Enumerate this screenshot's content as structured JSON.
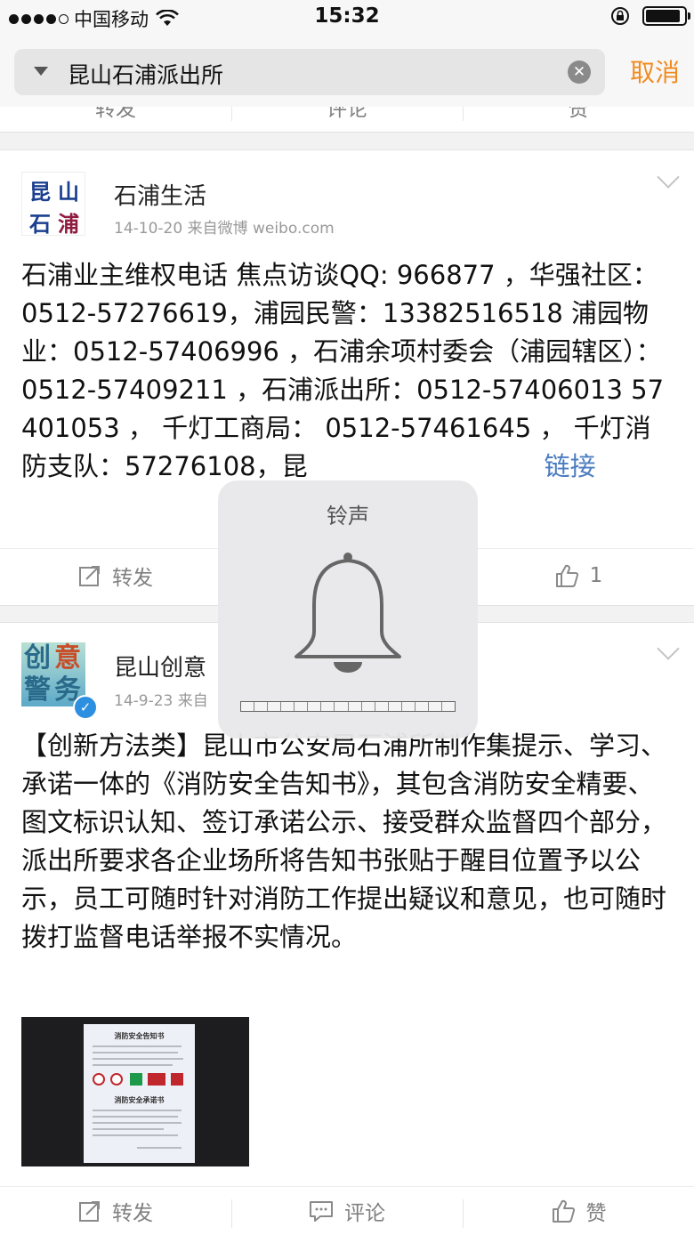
{
  "status_bar": {
    "carrier": "中国移动",
    "time": "15:32",
    "battery_level": 0.9
  },
  "search": {
    "query": "昆山石浦派出所",
    "cancel_label": "取消"
  },
  "posts": [
    {
      "avatar_chars": [
        "昆",
        "山",
        "石",
        "浦"
      ],
      "user_name": "石浦生活",
      "meta": "14-10-20  来自微博 weibo.com",
      "text_visible_left": "石浦业主维权电话 焦点访谈QQ: 966877 ，华强社区： 0512-57276619，浦园民警：13382516518 浦园物业：0512-57406996 ，石浦余项村委会（浦园辖区）： 0512-57409211 ，石浦派出所：0512-57406013 57401053 ， 千灯工商局： 0512-57461645 ， 千灯消防支队：57276108，昆",
      "link_text": "链接",
      "repost_label": "转发",
      "like_count": "1"
    },
    {
      "avatar_chars": [
        "创",
        "意",
        "警",
        "务"
      ],
      "user_name": "昆山创意",
      "meta": "14-9-23  来自",
      "text": "【创新方法类】昆山市公安局石浦所制作集提示、学习、承诺一体的《消防安全告知书》，其包含消防安全精要、图文标识认知、签订承诺公示、接受群众监督四个部分，派出所要求各企业场所将告知书张贴于醒目位置予以公示，员工可随时针对消防工作提出疑议和意见，也可随时拨打监督电话举报不实情况。",
      "photo": {
        "doc_title": "消防安全告知书",
        "doc_subtitle": "消防安全承诺书"
      },
      "repost_label": "转发",
      "comment_label": "评论",
      "like_label": "赞"
    }
  ],
  "prev_card_actions": [
    "转发",
    "评论",
    "赞"
  ],
  "volume_hud": {
    "title": "铃声",
    "level_fraction": 0.94,
    "segments": 16
  }
}
